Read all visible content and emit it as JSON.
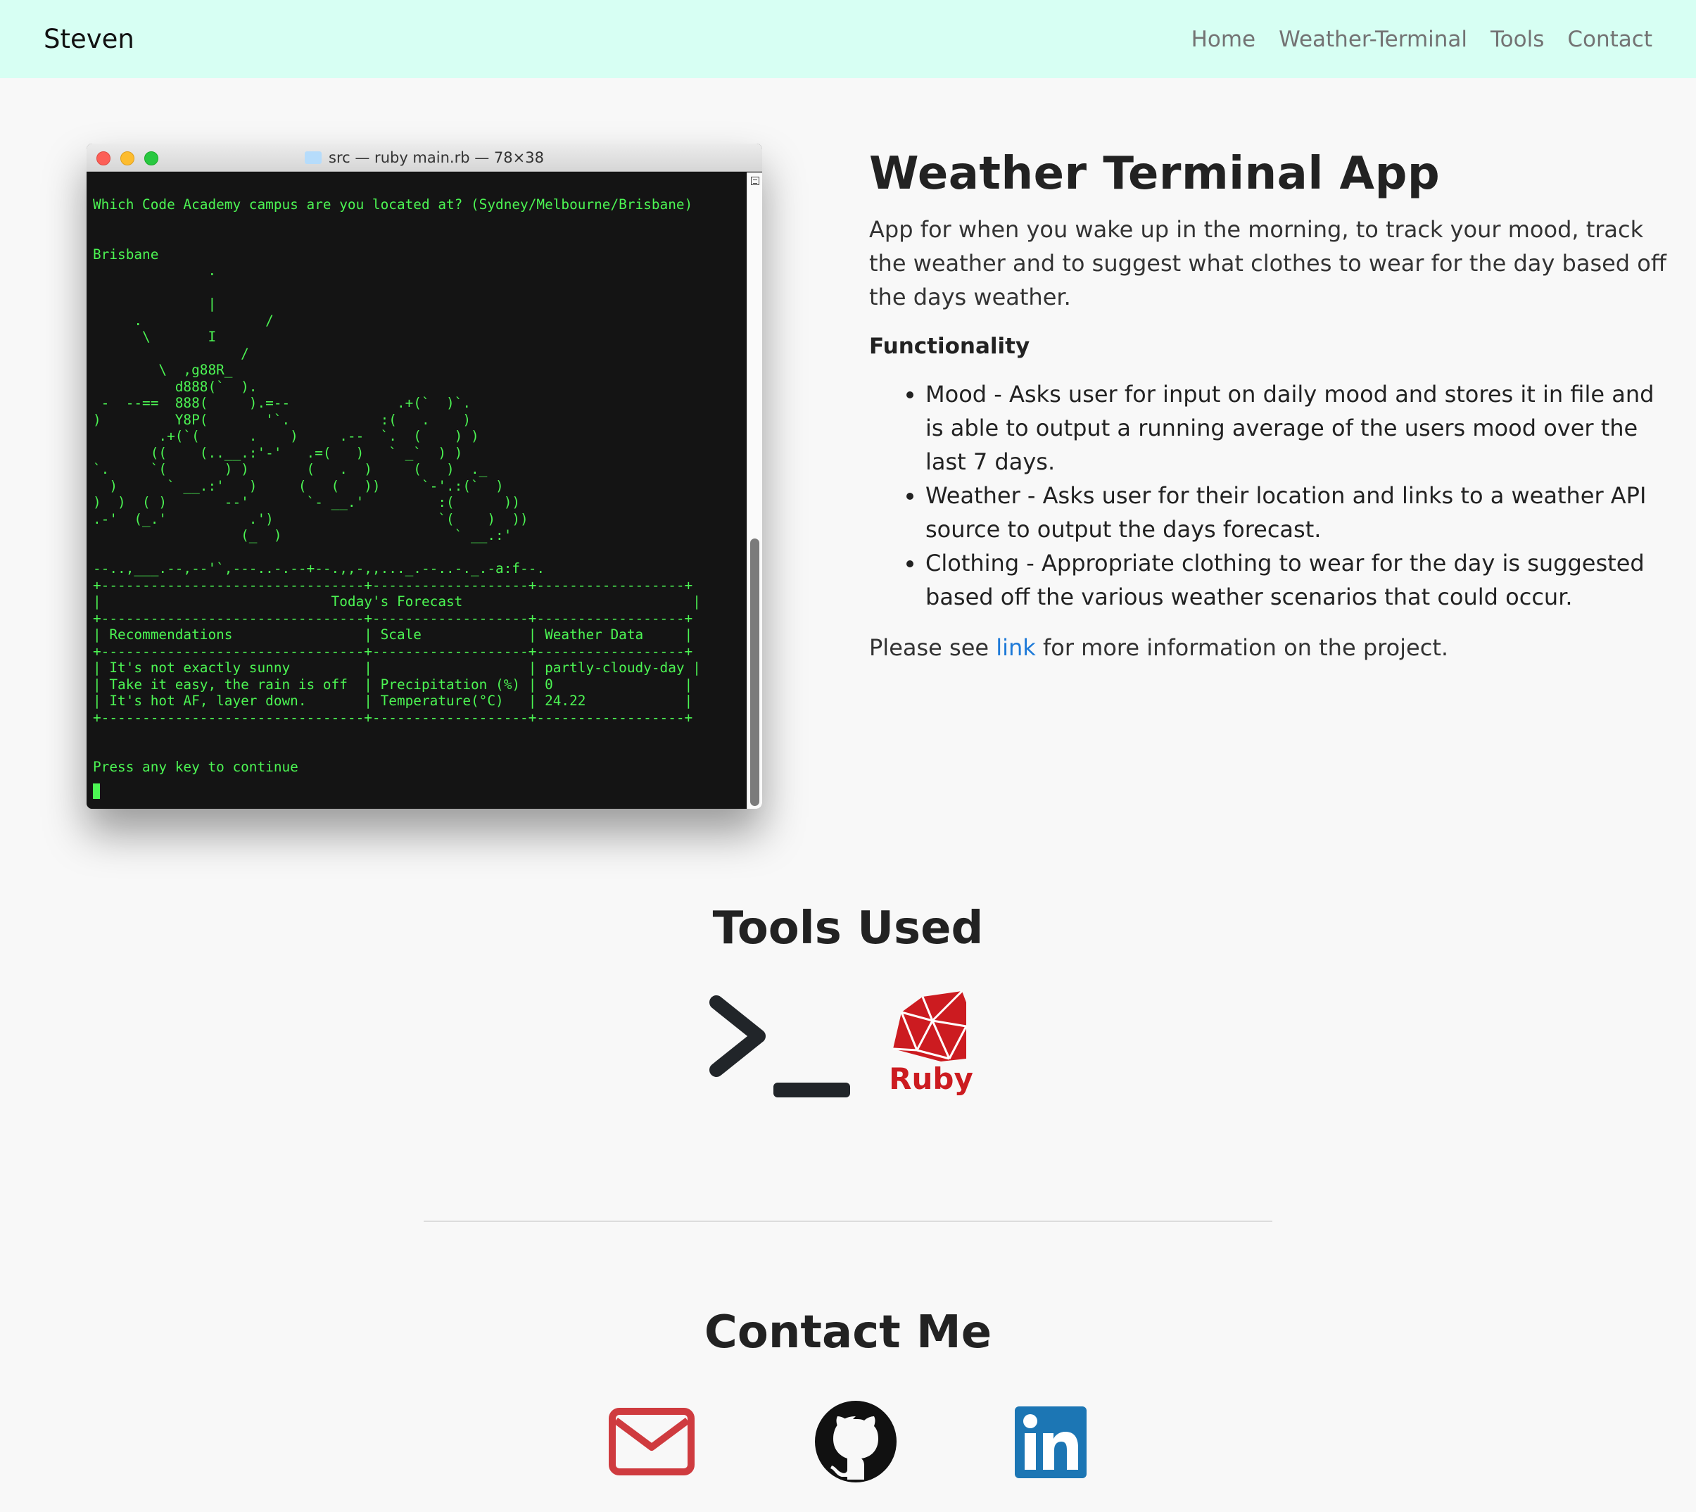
{
  "navbar": {
    "brand": "Steven",
    "links": [
      "Home",
      "Weather-Terminal",
      "Tools",
      "Contact"
    ]
  },
  "terminal": {
    "title": "src — ruby main.rb — 78×38",
    "output": "Which Code Academy campus are you located at? (Sydney/Melbourne/Brisbane)\n\n\nBrisbane\n              .\n\n              |\n     .               /\n      \\       I\n                  /\n        \\  ,g88R_\n          d888(`  ).\n -  --==  888(     ).=--             .+(`  )`.\n)         Y8P(       '`.           :(   .    )\n        .+(`(      .    )     .--  `.  (    ) )\n       ((    (..__.:'-'   .=(   )   ` _`  ) )\n`.     `(       ) )       (   .  )     (   )  ._\n  )      ` __.:'   )     (   (   ))     `-'.:(`  )\n)  )  ( )       --'       `- __.'         :(      ))\n.-'  (_.'          .')                    `(    )  ))\n                  (_  )                     ` __.:'\n\n--..,___.--,--'`,---..-.--+--.,,-,,..._.--..-._.-a:f--.\n+--------------------------------+-------------------+------------------+\n|                            Today's Forecast                            |\n+--------------------------------+-------------------+------------------+\n| Recommendations                | Scale             | Weather Data     |\n+--------------------------------+-------------------+------------------+\n| It's not exactly sunny         |                   | partly-cloudy-day |\n| Take it easy, the rain is off  | Precipitation (%) | 0                |\n| It's hot AF, layer down.       | Temperature(°C)   | 24.22            |\n+--------------------------------+-------------------+------------------+\n\n\nPress any key to continue"
  },
  "project": {
    "title": "Weather Terminal App",
    "description": "App for when you wake up in the morning, to track your mood, track the weather and to suggest what clothes to wear for the day based off the days weather.",
    "functionality_heading": "Functionality",
    "features": [
      "Mood - Asks user for input on daily mood and stores it in file and is able to output a running average of the users mood over the last 7 days.",
      "Weather - Asks user for their location and links to a weather API source to output the days forecast.",
      "Clothing - Appropriate clothing to wear for the day is suggested based off the various weather scenarios that could occur."
    ],
    "more_prefix": "Please see ",
    "more_link": "link",
    "more_suffix": " for more information on the project."
  },
  "tools": {
    "title": "Tools Used",
    "ruby_label": "Ruby",
    "icons": [
      "terminal-icon",
      "ruby-icon"
    ]
  },
  "contact": {
    "title": "Contact Me",
    "icons": [
      "email-icon",
      "github-icon",
      "linkedin-icon"
    ]
  },
  "colors": {
    "navbar_bg": "#d7fff3",
    "terminal_green": "#4cf553",
    "link_blue": "#1e7ad8",
    "ruby_red": "#cc1b20",
    "email_red": "#cf3b3f",
    "linkedin_blue": "#1c76b4"
  }
}
